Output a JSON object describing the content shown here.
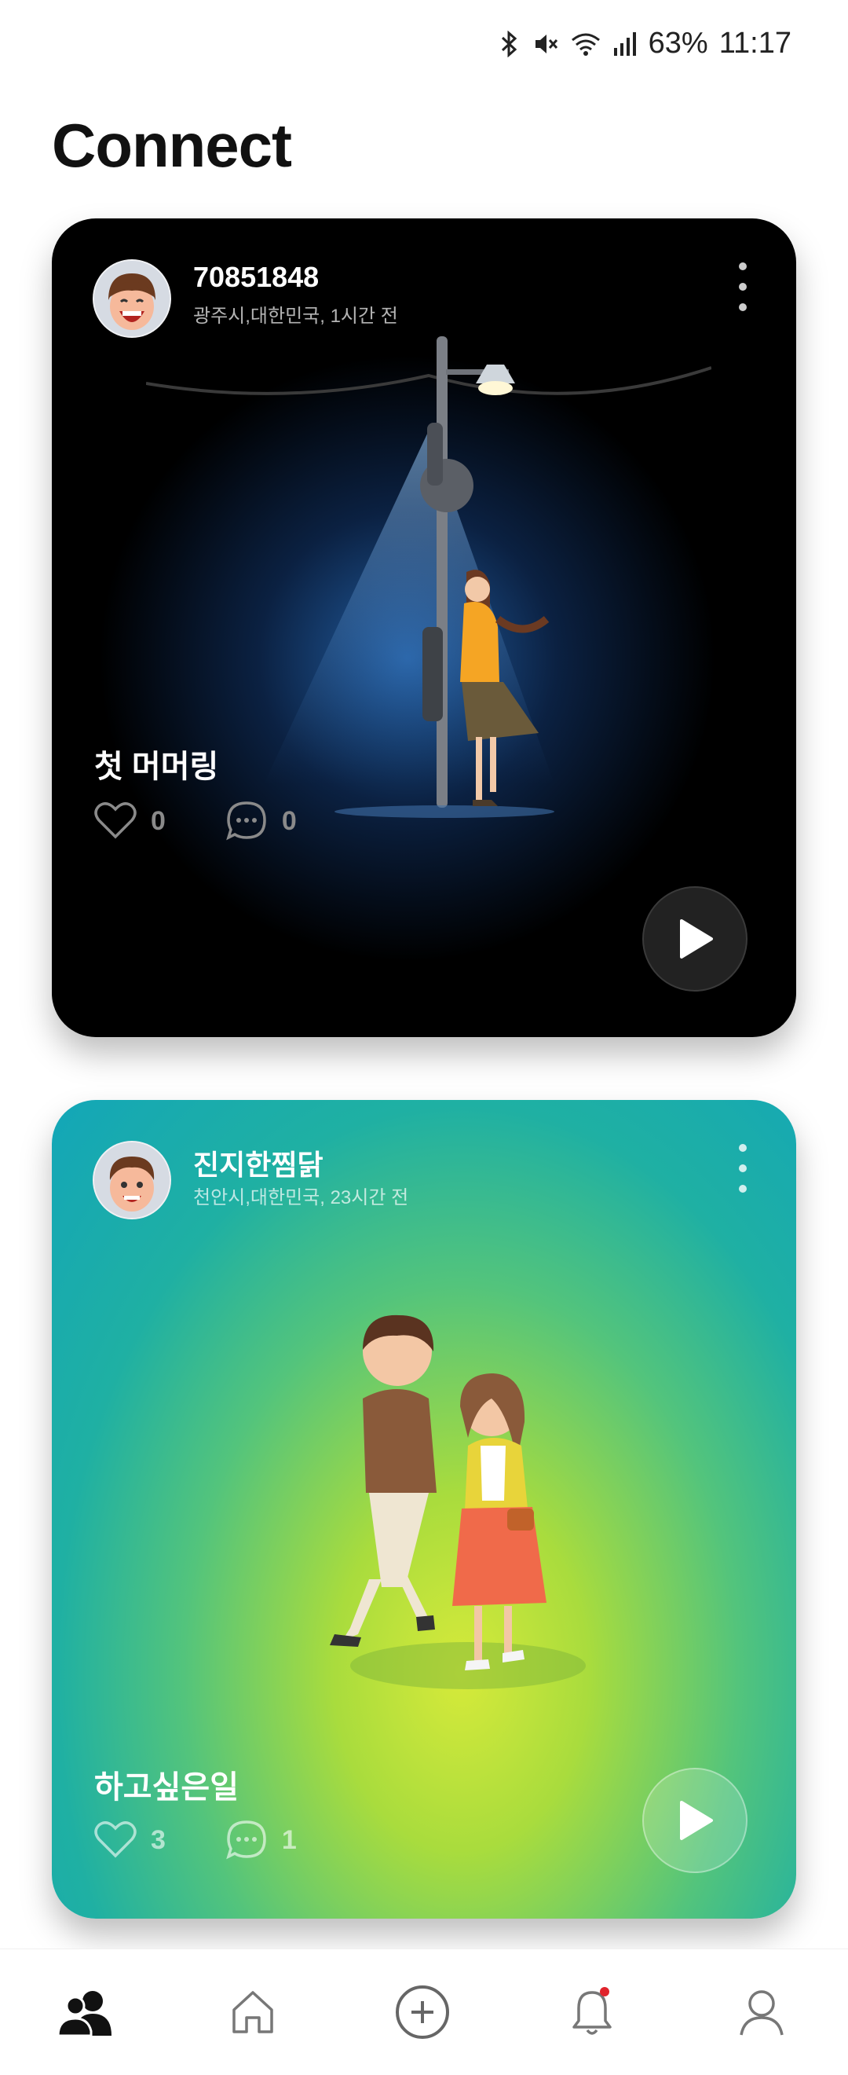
{
  "status_bar": {
    "battery": "63%",
    "time": "11:17",
    "icons": [
      "bluetooth-icon",
      "mute-icon",
      "wifi-icon",
      "signal-icon"
    ]
  },
  "page": {
    "title": "Connect"
  },
  "posts": [
    {
      "author": "70851848",
      "meta": "광주시,대한민국, 1시간 전",
      "title": "첫 머머링",
      "likes": "0",
      "comments": "0",
      "illustration": "girl-under-streetlamp",
      "theme_color": "#000000"
    },
    {
      "author": "진지한찜닭",
      "meta": "천안시,대한민국, 23시간 전",
      "title": "하고싶은일",
      "likes": "3",
      "comments": "1",
      "illustration": "couple-walking",
      "theme_color": "#1fb0a3"
    }
  ],
  "bottom_nav": {
    "items": [
      "connect-icon",
      "home-icon",
      "add-icon",
      "notifications-icon",
      "profile-icon"
    ],
    "active": "connect-icon",
    "notification_badge_color": "#e0242c"
  }
}
